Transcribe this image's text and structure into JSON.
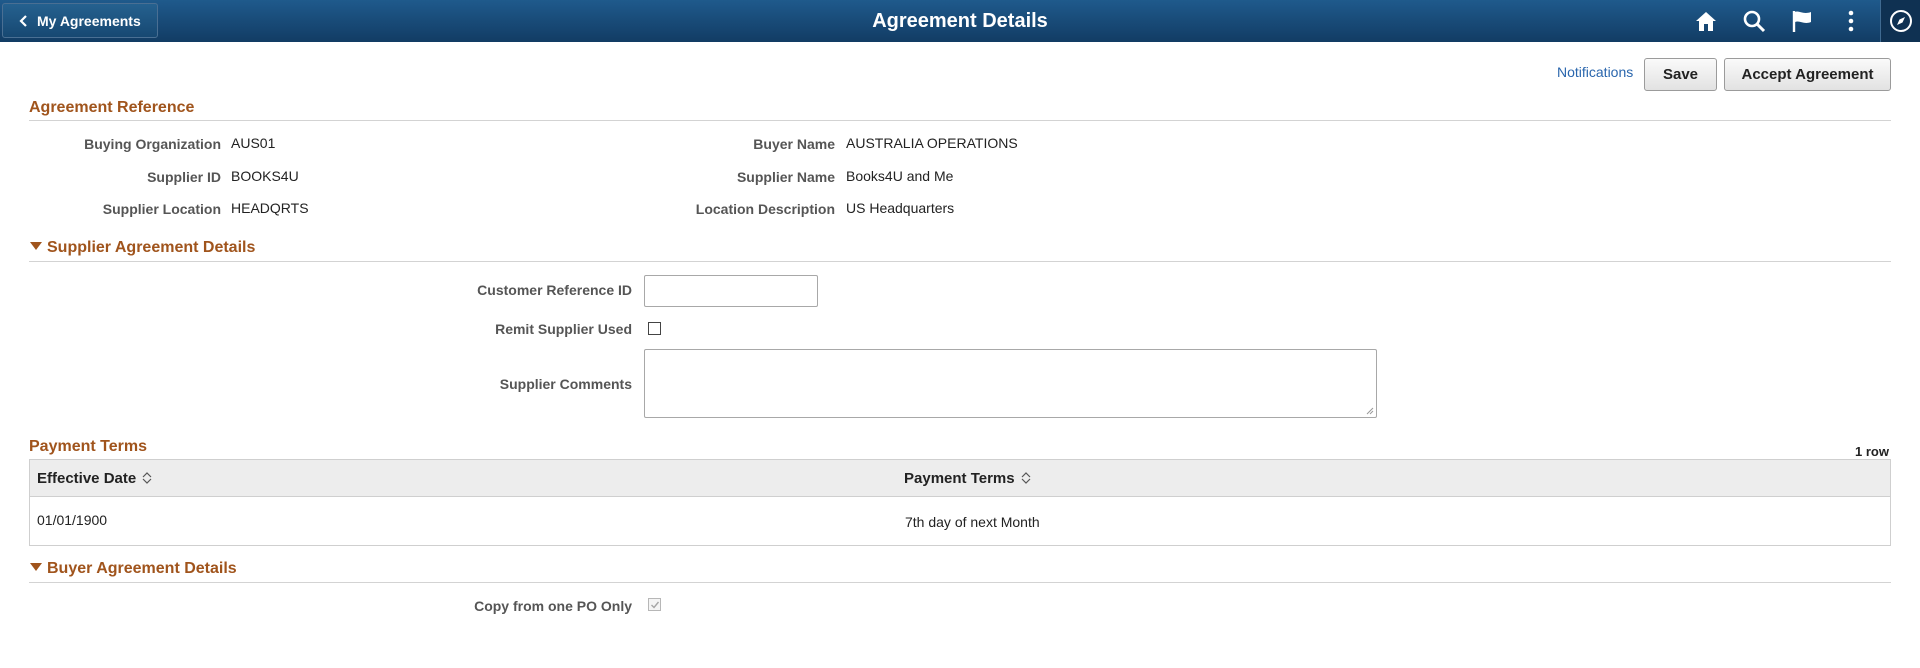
{
  "header": {
    "back_label": "My Agreements",
    "title": "Agreement Details",
    "icons": [
      "home-icon",
      "search-icon",
      "flag-icon",
      "more-vertical-icon",
      "compass-icon"
    ]
  },
  "actions": {
    "notifications_label": "Notifications",
    "save_label": "Save",
    "accept_label": "Accept Agreement"
  },
  "agreement_reference": {
    "title": "Agreement Reference",
    "fields": {
      "buying_org_label": "Buying Organization",
      "buying_org_value": "AUS01",
      "buyer_name_label": "Buyer Name",
      "buyer_name_value": "AUSTRALIA OPERATIONS",
      "supplier_id_label": "Supplier ID",
      "supplier_id_value": "BOOKS4U",
      "supplier_name_label": "Supplier Name",
      "supplier_name_value": "Books4U and Me",
      "supplier_location_label": "Supplier Location",
      "supplier_location_value": "HEADQRTS",
      "location_desc_label": "Location Description",
      "location_desc_value": "US Headquarters"
    }
  },
  "supplier_details": {
    "title": "Supplier Agreement Details",
    "customer_ref_label": "Customer Reference ID",
    "customer_ref_value": "",
    "remit_label": "Remit Supplier Used",
    "remit_checked": false,
    "comments_label": "Supplier Comments",
    "comments_value": ""
  },
  "payment_terms": {
    "title": "Payment Terms",
    "row_count": "1 row",
    "columns": [
      "Effective Date",
      "Payment Terms"
    ],
    "rows": [
      [
        "01/01/1900",
        "7th day of next Month"
      ]
    ]
  },
  "buyer_details": {
    "title": "Buyer Agreement Details",
    "copy_label": "Copy from one PO Only",
    "copy_checked": true
  },
  "colors": {
    "header_bg": "#1a4f7d",
    "section_title": "#a0541c",
    "link": "#2a66ad"
  }
}
